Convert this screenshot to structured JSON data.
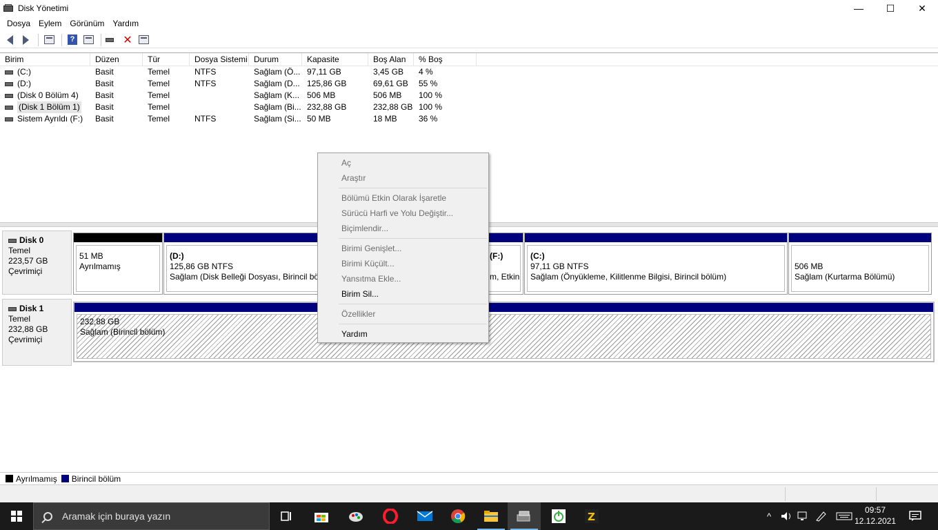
{
  "window": {
    "title": "Disk Yönetimi",
    "minimize": "—",
    "maximize": "☐",
    "close": "✕"
  },
  "menu": [
    {
      "label": "Dosya"
    },
    {
      "label": "Eylem"
    },
    {
      "label": "Görünüm"
    },
    {
      "label": "Yardım"
    }
  ],
  "list": {
    "headers": [
      "Birim",
      "Düzen",
      "Tür",
      "Dosya Sistemi",
      "Durum",
      "Kapasite",
      "Boş Alan",
      "% Boş"
    ],
    "rows": [
      [
        "(C:)",
        "Basit",
        "Temel",
        "NTFS",
        "Sağlam (Ö...",
        "97,11 GB",
        "3,45 GB",
        "4 %"
      ],
      [
        "(D:)",
        "Basit",
        "Temel",
        "NTFS",
        "Sağlam (D...",
        "125,86 GB",
        "69,61 GB",
        "55 %"
      ],
      [
        "(Disk 0 Bölüm 4)",
        "Basit",
        "Temel",
        "",
        "Sağlam (K...",
        "506 MB",
        "506 MB",
        "100 %"
      ],
      [
        "(Disk 1 Bölüm 1)",
        "Basit",
        "Temel",
        "",
        "Sağlam (Bi...",
        "232,88 GB",
        "232,88 GB",
        "100 %"
      ],
      [
        "Sistem Ayrıldı (F:)",
        "Basit",
        "Temel",
        "NTFS",
        "Sağlam (Si...",
        "50 MB",
        "18 MB",
        "36 %"
      ]
    ]
  },
  "disks": {
    "disk0": {
      "name": "Disk 0",
      "type": "Temel",
      "size": "223,57 GB",
      "status": "Çevrimiçi",
      "partitions": {
        "unalloc": {
          "size": "51 MB",
          "desc": "Ayrılmamış"
        },
        "d": {
          "title": "(D:)",
          "size": "125,86 GB NTFS",
          "desc": "Sağlam (Disk Belleği Dosyası, Birincil bölüm)"
        },
        "f": {
          "title": "(F:)",
          "desc": "m, Etkin,"
        },
        "c": {
          "title": "(C:)",
          "size": "97,11 GB NTFS",
          "desc": "Sağlam (Önyükleme, Kilitlenme Bilgisi, Birincil bölüm)"
        },
        "recovery": {
          "size": "506 MB",
          "desc": "Sağlam (Kurtarma Bölümü)"
        }
      }
    },
    "disk1": {
      "name": "Disk 1",
      "type": "Temel",
      "size": "232,88 GB",
      "status": "Çevrimiçi",
      "partitions": {
        "p1": {
          "size": "232,88 GB",
          "desc": "Sağlam (Birincil bölüm)"
        }
      }
    }
  },
  "legend": {
    "unallocated": "Ayrılmamış",
    "primary": "Birincil bölüm"
  },
  "context_menu": {
    "open": "Aç",
    "explore": "Araştır",
    "mark_active": "Bölümü Etkin Olarak İşaretle",
    "change_letter": "Sürücü Harfi ve Yolu Değiştir...",
    "format": "Biçimlendir...",
    "extend": "Birimi Genişlet...",
    "shrink": "Birimi Küçült...",
    "add_mirror": "Yansıtma Ekle...",
    "delete": "Birim Sil...",
    "properties": "Özellikler",
    "help": "Yardım"
  },
  "taskbar": {
    "search_placeholder": "Aramak için buraya yazın",
    "time": "09:57",
    "date": "12.12.2021"
  },
  "colors": {
    "primary_partition": "#00007f",
    "unallocated": "#000000",
    "taskbar": "#1a1a1a"
  }
}
